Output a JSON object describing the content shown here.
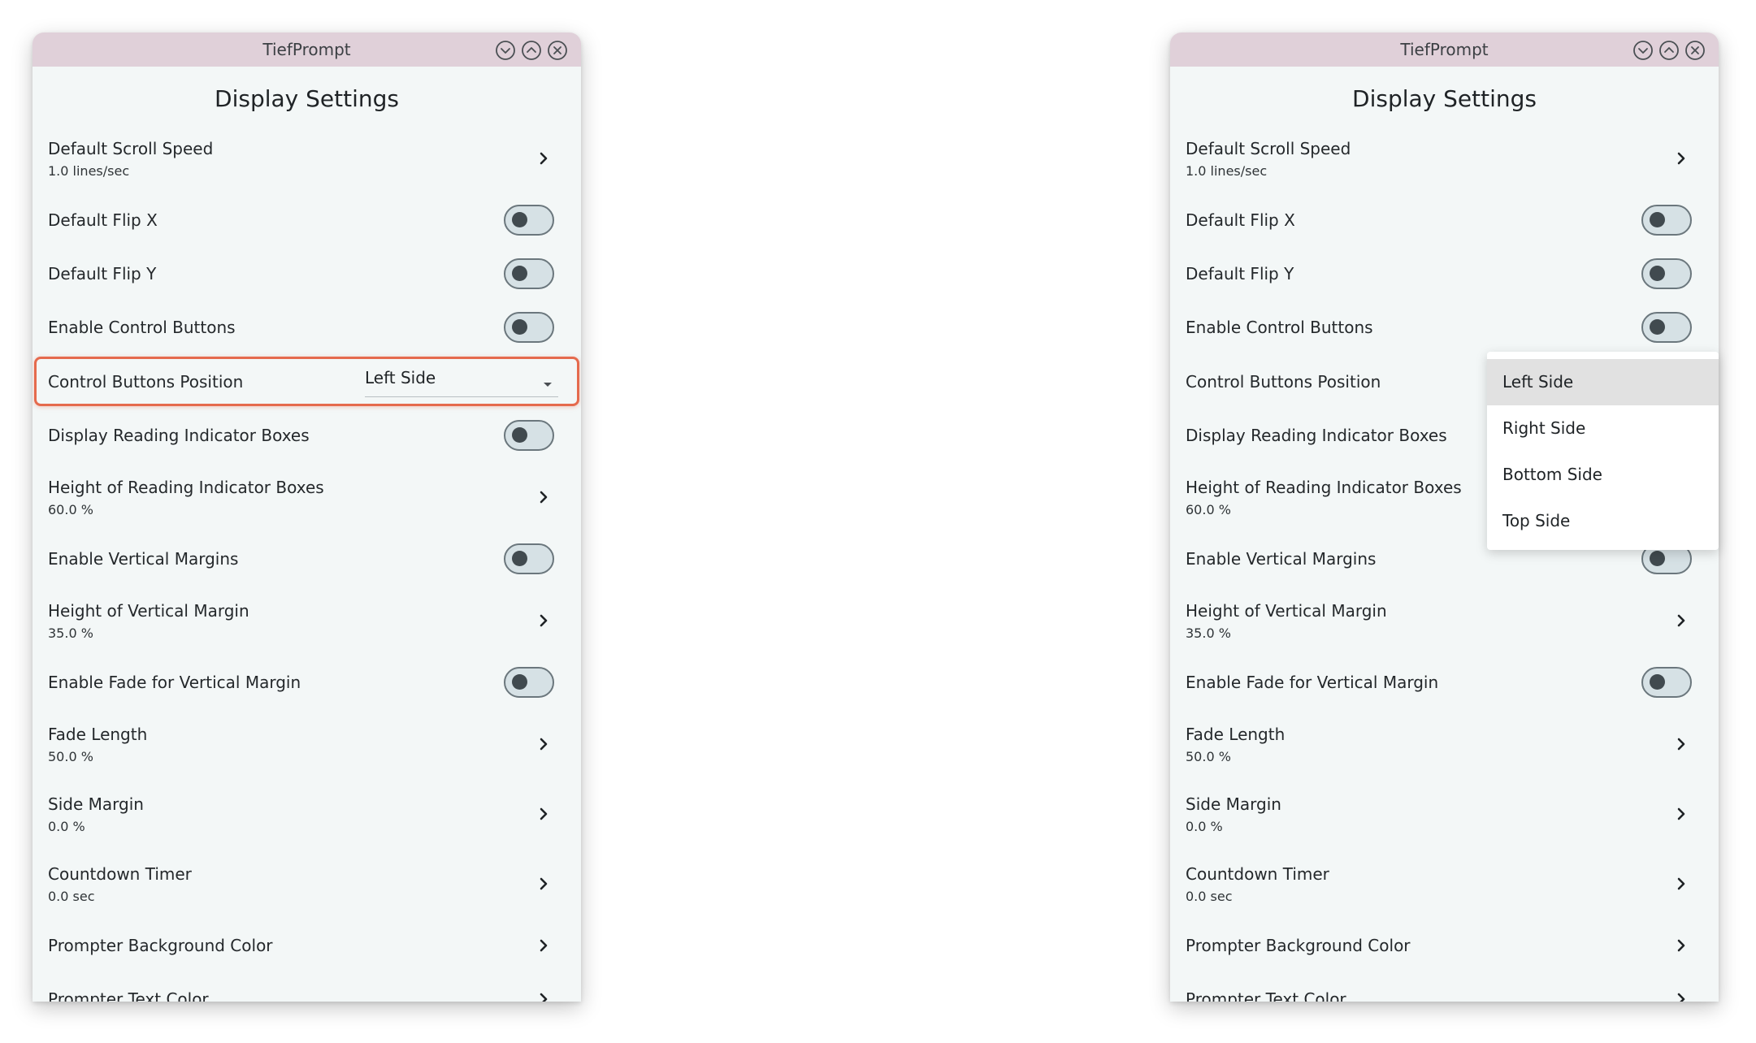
{
  "app_title": "TiefPrompt",
  "page_title": "Display Settings",
  "window_controls": {
    "minimize_icon": "chevron-down-circle",
    "maximize_icon": "chevron-up-circle",
    "close_icon": "x-circle"
  },
  "rows": [
    {
      "label": "Default Scroll Speed",
      "sub": "1.0 lines/sec",
      "kind": "nav"
    },
    {
      "label": "Default Flip X",
      "kind": "toggle",
      "on": false
    },
    {
      "label": "Default Flip Y",
      "kind": "toggle",
      "on": false
    },
    {
      "label": "Enable Control Buttons",
      "kind": "toggle",
      "on": false
    },
    {
      "label": "Control Buttons Position",
      "kind": "dropdown",
      "value": "Left Side"
    },
    {
      "label": "Display Reading Indicator Boxes",
      "kind": "toggle",
      "on": false
    },
    {
      "label": "Height of Reading Indicator Boxes",
      "sub": "60.0 %",
      "kind": "nav"
    },
    {
      "label": "Enable Vertical Margins",
      "kind": "toggle",
      "on": false
    },
    {
      "label": "Height of Vertical Margin",
      "sub": "35.0 %",
      "kind": "nav"
    },
    {
      "label": "Enable Fade for Vertical Margin",
      "kind": "toggle",
      "on": false
    },
    {
      "label": "Fade Length",
      "sub": "50.0 %",
      "kind": "nav"
    },
    {
      "label": "Side Margin",
      "sub": "0.0 %",
      "kind": "nav"
    },
    {
      "label": "Countdown Timer",
      "sub": "0.0 sec",
      "kind": "nav"
    },
    {
      "label": "Prompter Background Color",
      "kind": "nav"
    },
    {
      "label": "Prompter Text Color",
      "kind": "nav"
    }
  ],
  "dropdown_menu": {
    "options": [
      "Left Side",
      "Right Side",
      "Bottom Side",
      "Top Side"
    ],
    "selected": "Left Side"
  },
  "colors": {
    "titlebar": "#e0d0d9",
    "content_bg": "#f3f7f7",
    "focus_outline": "#e56a4d",
    "toggle_track": "#d6e1e5",
    "toggle_knob": "#414a4f"
  }
}
